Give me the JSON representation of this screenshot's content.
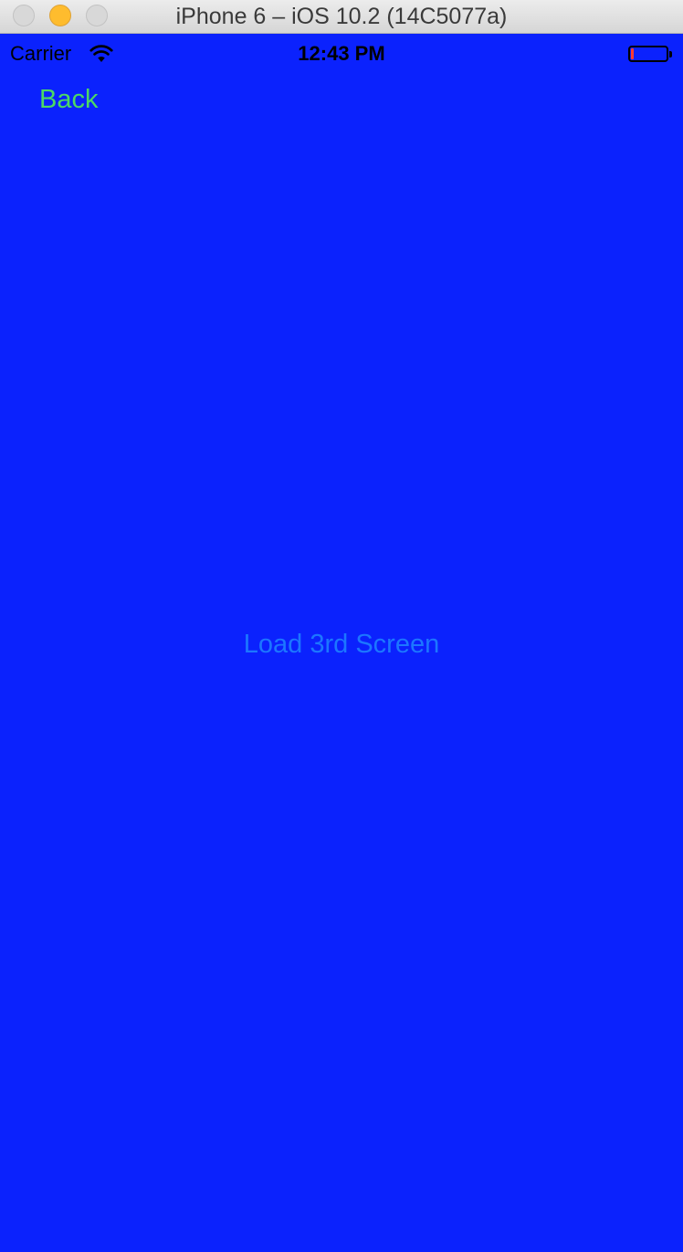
{
  "window": {
    "title": "iPhone 6 – iOS 10.2 (14C5077a)"
  },
  "status_bar": {
    "carrier": "Carrier",
    "time": "12:43 PM",
    "battery_level": 0.05,
    "icons": [
      "wifi-icon",
      "battery-icon"
    ]
  },
  "nav": {
    "back_label": "Back"
  },
  "main": {
    "load_button_label": "Load 3rd Screen"
  },
  "colors": {
    "background": "#0b22fd",
    "back_button": "#4cd964",
    "load_button": "#1c77ff",
    "battery_low": "#ff3b30"
  }
}
